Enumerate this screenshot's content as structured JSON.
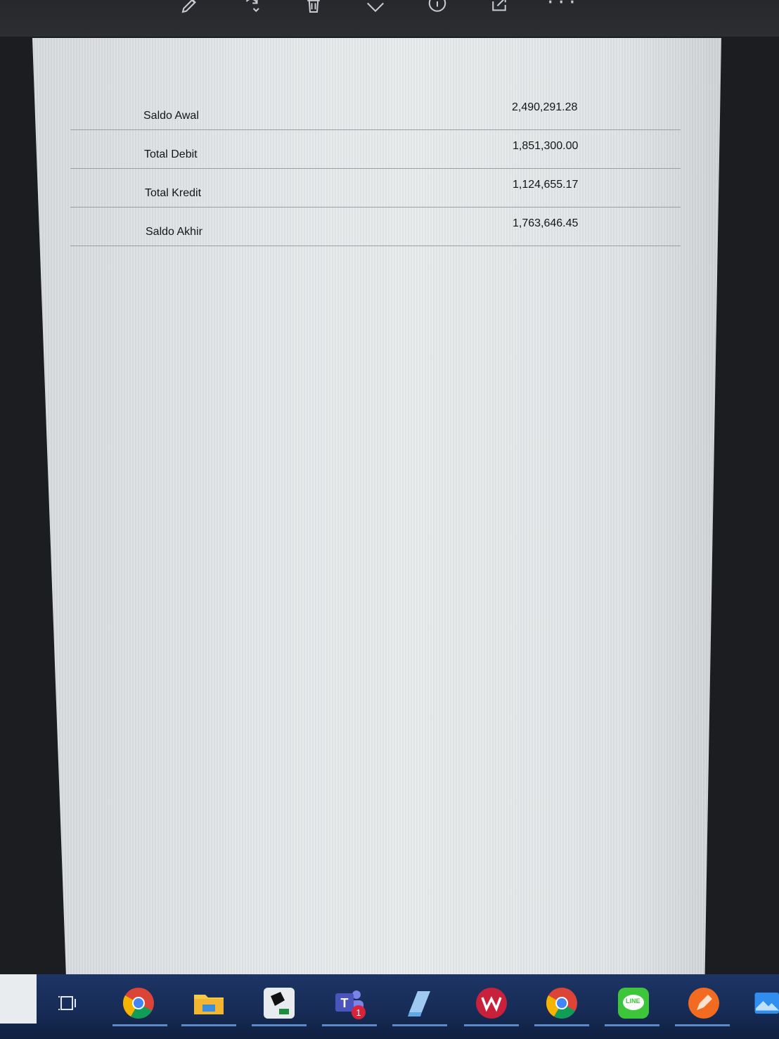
{
  "toolbar": {
    "icons": [
      "edit-pen-icon",
      "rotate-icon",
      "trash-icon",
      "favorite-icon",
      "info-icon",
      "share-icon"
    ],
    "more_label": "···"
  },
  "summary": {
    "rows": [
      {
        "label": "Saldo Awal",
        "value": "2,490,291.28"
      },
      {
        "label": "Total Debit",
        "value": "1,851,300.00"
      },
      {
        "label": "Total Kredit",
        "value": "1,124,655.17"
      },
      {
        "label": "Saldo Akhir",
        "value": "1,763,646.45"
      }
    ]
  },
  "taskbar": {
    "apps": [
      "task-view-icon",
      "chrome-icon",
      "file-explorer-icon",
      "app-tile-icon",
      "teams-icon",
      "notes-icon",
      "wps-office-icon",
      "chrome-icon",
      "line-icon",
      "pen-app-icon",
      "photos-icon"
    ],
    "teams_badge": "1",
    "line_label": "LINE"
  }
}
